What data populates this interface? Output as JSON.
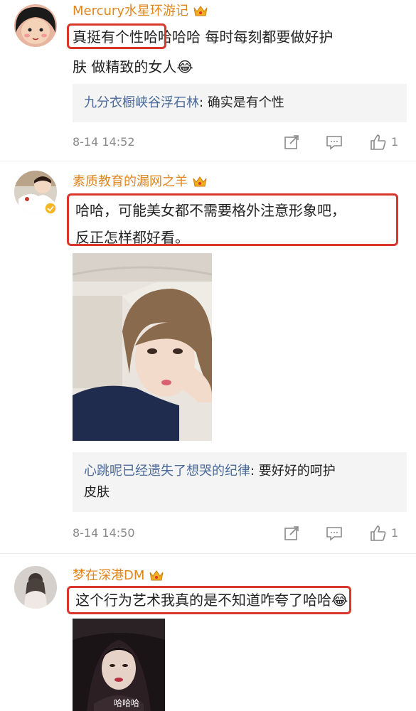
{
  "comments": [
    {
      "username": "Mercury水星环游记",
      "text_line1": "真挺有个性哈哈哈哈 每时每刻都要做好护",
      "text_line2": "肤 做精致的女人😂",
      "reply_name": "九分衣橱峡谷浮石林",
      "reply_text": ": 确实是有个性",
      "timestamp": "8-14 14:52",
      "likes": "1"
    },
    {
      "username": "素质教育的漏网之羊",
      "text_line1": "哈哈，可能美女都不需要格外注意形象吧，",
      "text_line2": "反正怎样都好看。",
      "reply_name": "心跳呢已经遗失了想哭的纪律",
      "reply_text": ": 要好好的呵护",
      "reply_text2": "皮肤",
      "timestamp": "8-14 14:50",
      "likes": "1"
    },
    {
      "username": "梦在深港DM",
      "text_line1": "这个行为艺术我真的是不知道咋夸了哈哈😂",
      "photo_caption": "哈哈哈"
    }
  ],
  "colors": {
    "username": "#e0861f",
    "reply_name": "#4a6a9a",
    "highlight": "#d9372b",
    "meta": "#8a8a8a"
  },
  "icons": [
    "vip-crown-icon",
    "share-icon",
    "comment-icon",
    "like-icon",
    "verified-badge-icon"
  ]
}
